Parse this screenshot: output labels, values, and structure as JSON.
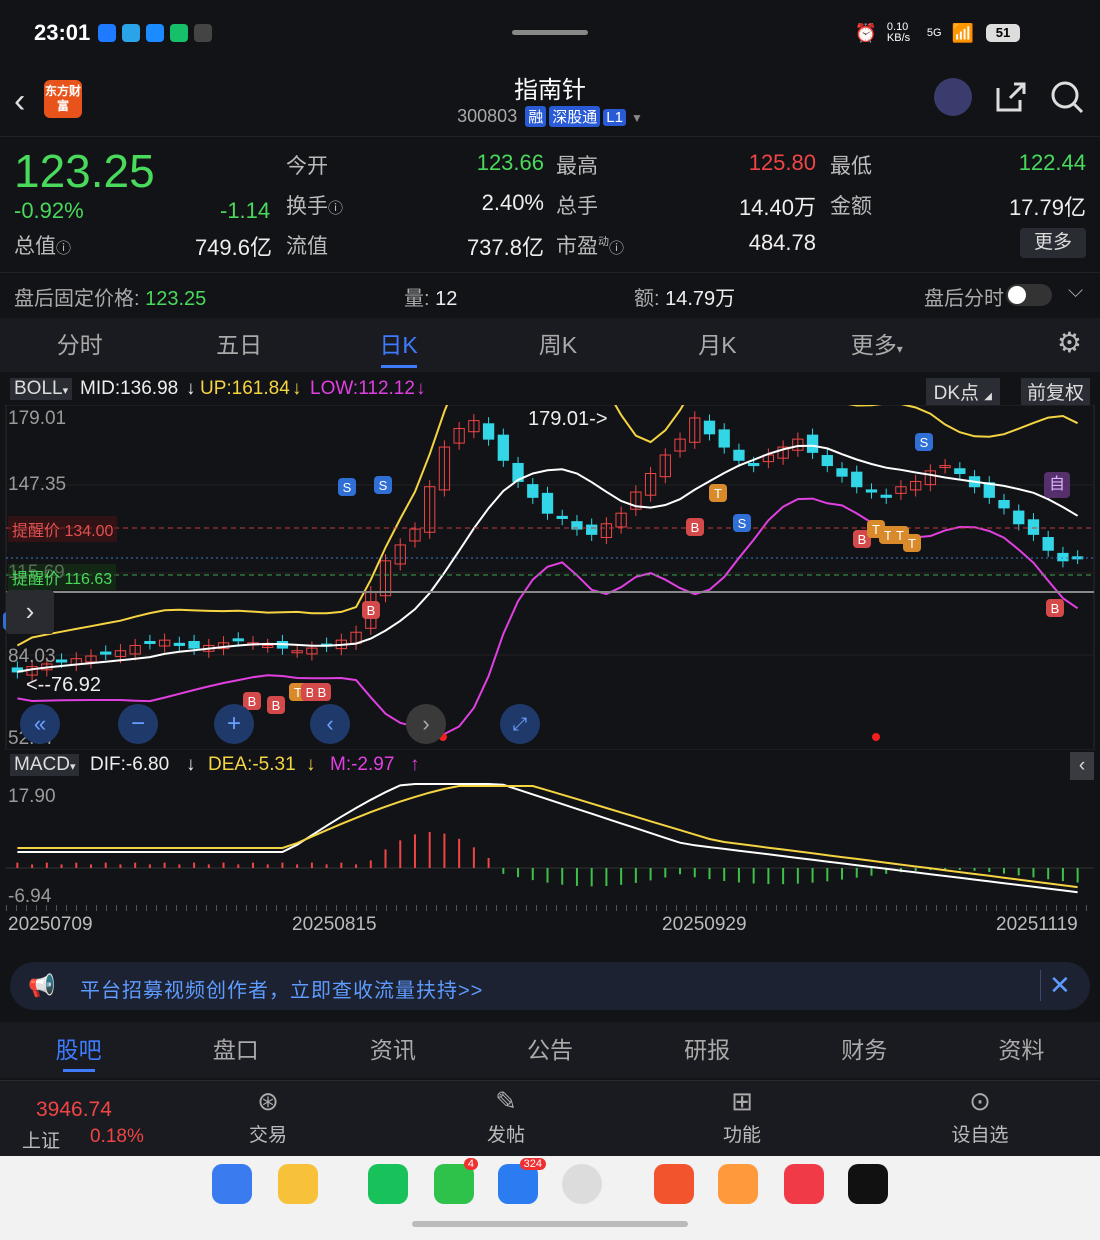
{
  "status_bar": {
    "time": "23:01",
    "net_speed": "0.10 KB/s",
    "network": "5G",
    "battery": "51"
  },
  "header": {
    "title": "指南针",
    "code": "300803",
    "tags": [
      "融",
      "深股通",
      "L1"
    ],
    "logo_text": "东方财富"
  },
  "quote": {
    "price": "123.25",
    "change_pct": "-0.92%",
    "change": "-1.14",
    "open_label": "今开",
    "open": "123.66",
    "high_label": "最高",
    "high": "125.80",
    "low_label": "最低",
    "low": "122.44",
    "turnover_label": "换手",
    "turnover": "2.40%",
    "volume_label": "总手",
    "volume": "14.40万",
    "amount_label": "金额",
    "amount": "17.79亿",
    "mcap_label": "总值",
    "mcap": "749.6亿",
    "float_label": "流值",
    "float": "737.8亿",
    "pe_label": "市盈",
    "pe_sup": "动",
    "pe": "484.78",
    "more": "更多"
  },
  "after_hours": {
    "fixed_price_label": "盘后固定价格:",
    "fixed_price": "123.25",
    "vol_label": "量:",
    "vol": "12",
    "amt_label": "额:",
    "amt": "14.79万",
    "minute_label": "盘后分时"
  },
  "tabs": [
    "分时",
    "五日",
    "日K",
    "周K",
    "月K",
    "更多"
  ],
  "active_tab": 2,
  "chart_bar": {
    "indicator": "BOLL",
    "mid": "MID:136.98",
    "up": "UP:161.84",
    "low": "LOW:112.12",
    "dk": "DK点",
    "fq": "前复权"
  },
  "price_axis": {
    "t1": "179.01",
    "t2": "147.35",
    "t3": "115.69",
    "t4": "84.03",
    "t5": "52.37"
  },
  "annotations": {
    "high_marker": "179.01->",
    "low_marker": "<--76.92",
    "alert_high": "提醒价 134.00",
    "alert_low": "提醒价 116.63",
    "self_mark": "自"
  },
  "macd_bar": {
    "indicator": "MACD",
    "dif": "DIF:-6.80",
    "dea": "DEA:-5.31",
    "m": "M:-2.97"
  },
  "macd_axis": {
    "top": "17.90",
    "bottom": "-6.94"
  },
  "dates": [
    "20250709",
    "20250815",
    "20250929",
    "20251119"
  ],
  "banner": {
    "text": "平台招募视频创作者，立即查收流量扶持>>"
  },
  "subtabs": [
    "股吧",
    "盘口",
    "资讯",
    "公告",
    "研报",
    "财务",
    "资料"
  ],
  "bottom_bar": {
    "index_value": "3946.74",
    "index_name": "上证",
    "index_pct": "0.18%",
    "trade": "交易",
    "post": "发帖",
    "func": "功能",
    "watch": "设自选"
  },
  "dock_badges": {
    "wechat": "4",
    "msg": "324"
  },
  "chart_data": {
    "type": "candlestick",
    "xlabel": "",
    "ylabel": "",
    "ylim": [
      52.37,
      179.01
    ],
    "x": [
      "20250709",
      "20250815",
      "20250929",
      "20251119"
    ],
    "series": [
      {
        "name": "MID",
        "last": 136.98
      },
      {
        "name": "UP",
        "last": 161.84
      },
      {
        "name": "LOW",
        "last": 112.12
      }
    ],
    "close_approx": [
      80,
      82,
      83,
      84,
      85,
      86,
      87,
      88,
      90,
      91,
      92,
      90,
      89,
      90,
      91,
      92,
      91,
      90,
      89,
      88,
      89,
      90,
      92,
      95,
      110,
      122,
      128,
      134,
      150,
      165,
      172,
      175,
      168,
      160,
      152,
      146,
      140,
      138,
      134,
      132,
      136,
      140,
      148,
      155,
      162,
      168,
      176,
      170,
      165,
      160,
      158,
      162,
      165,
      168,
      163,
      158,
      154,
      150,
      148,
      146,
      150,
      152,
      156,
      158,
      155,
      150,
      146,
      142,
      136,
      132,
      126,
      122,
      123.25
    ],
    "macd_ylim": [
      -6.94,
      17.9
    ]
  }
}
